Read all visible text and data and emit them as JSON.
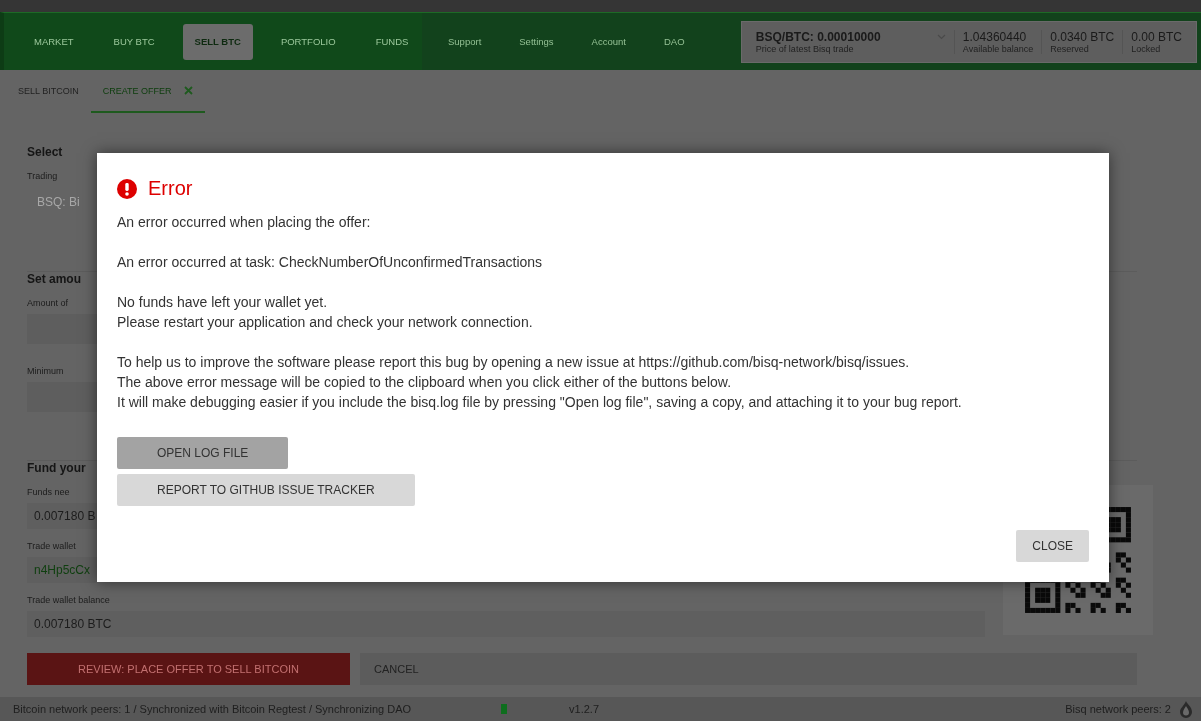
{
  "nav": {
    "tabs": [
      {
        "label": "MARKET",
        "selected": false
      },
      {
        "label": "BUY BTC",
        "selected": false
      },
      {
        "label": "SELL BTC",
        "selected": true
      },
      {
        "label": "PORTFOLIO",
        "selected": false
      },
      {
        "label": "FUNDS",
        "selected": false
      }
    ],
    "secondary": [
      {
        "label": "Support"
      },
      {
        "label": "Settings"
      },
      {
        "label": "Account"
      },
      {
        "label": "DAO"
      }
    ],
    "balances": [
      {
        "value": "BSQ/BTC: 0.00010000",
        "label": "Price of latest Bisq trade",
        "kind": "price"
      },
      {
        "value": "1.04360440",
        "label": "Available balance",
        "kind": "plain"
      },
      {
        "value": "0.0340 BTC",
        "label": "Reserved",
        "kind": "plain"
      },
      {
        "value": "0.00 BTC",
        "label": "Locked",
        "kind": "plain"
      }
    ]
  },
  "subtabs": [
    {
      "label": "SELL BITCOIN",
      "selected": false,
      "closable": false
    },
    {
      "label": "CREATE OFFER",
      "selected": true,
      "closable": true
    }
  ],
  "form": {
    "sections": [
      {
        "heading": "Select",
        "fields": [
          {
            "label": "Trading",
            "value": "BSQ: Bi",
            "kind": "select"
          }
        ]
      },
      {
        "heading": "Set amou",
        "fields": [
          {
            "label": "Amount of",
            "kind": "input"
          },
          {
            "label": "Minimum",
            "kind": "input"
          }
        ]
      }
    ],
    "fund": {
      "heading": "Fund your",
      "fields": [
        {
          "label": "Funds nee",
          "value": "0.007180 B",
          "kind": "text"
        },
        {
          "label": "Trade wallet",
          "value": "n4Hp5cCx",
          "kind": "address"
        },
        {
          "label": "Trade wallet balance",
          "value": "0.007180 BTC",
          "kind": "wide"
        }
      ]
    },
    "buttons": [
      {
        "label": "REVIEW: PLACE OFFER TO SELL BITCOIN",
        "kind": "primary"
      },
      {
        "label": "CANCEL",
        "kind": "secondary"
      }
    ]
  },
  "status_bar": {
    "text": "Bitcoin network peers: 1 / Synchronized with Bitcoin Regtest / Synchronizing DAO",
    "version": "v1.2.7",
    "peers": "Bisq network peers: 2"
  },
  "dialog": {
    "title": "Error",
    "paragraphs": [
      [
        "An error occurred when placing the offer:"
      ],
      [
        "An error occurred at task: CheckNumberOfUnconfirmedTransactions"
      ],
      [
        "No funds have left your wallet yet.",
        "Please restart your application and check your network connection."
      ],
      [
        "To help us to improve the software please report this bug by opening a new issue at https://github.com/bisq-network/bisq/issues.",
        "The above error message will be copied to the clipboard when you click either of the buttons below.",
        "It will make debugging easier if you include the bisq.log file by pressing \"Open log file\", saving a copy, and attaching it to your bug report."
      ]
    ],
    "actions": [
      {
        "label": "OPEN LOG FILE",
        "default": true
      },
      {
        "label": "REPORT TO GITHUB ISSUE TRACKER",
        "default": false
      }
    ],
    "close": "CLOSE"
  }
}
